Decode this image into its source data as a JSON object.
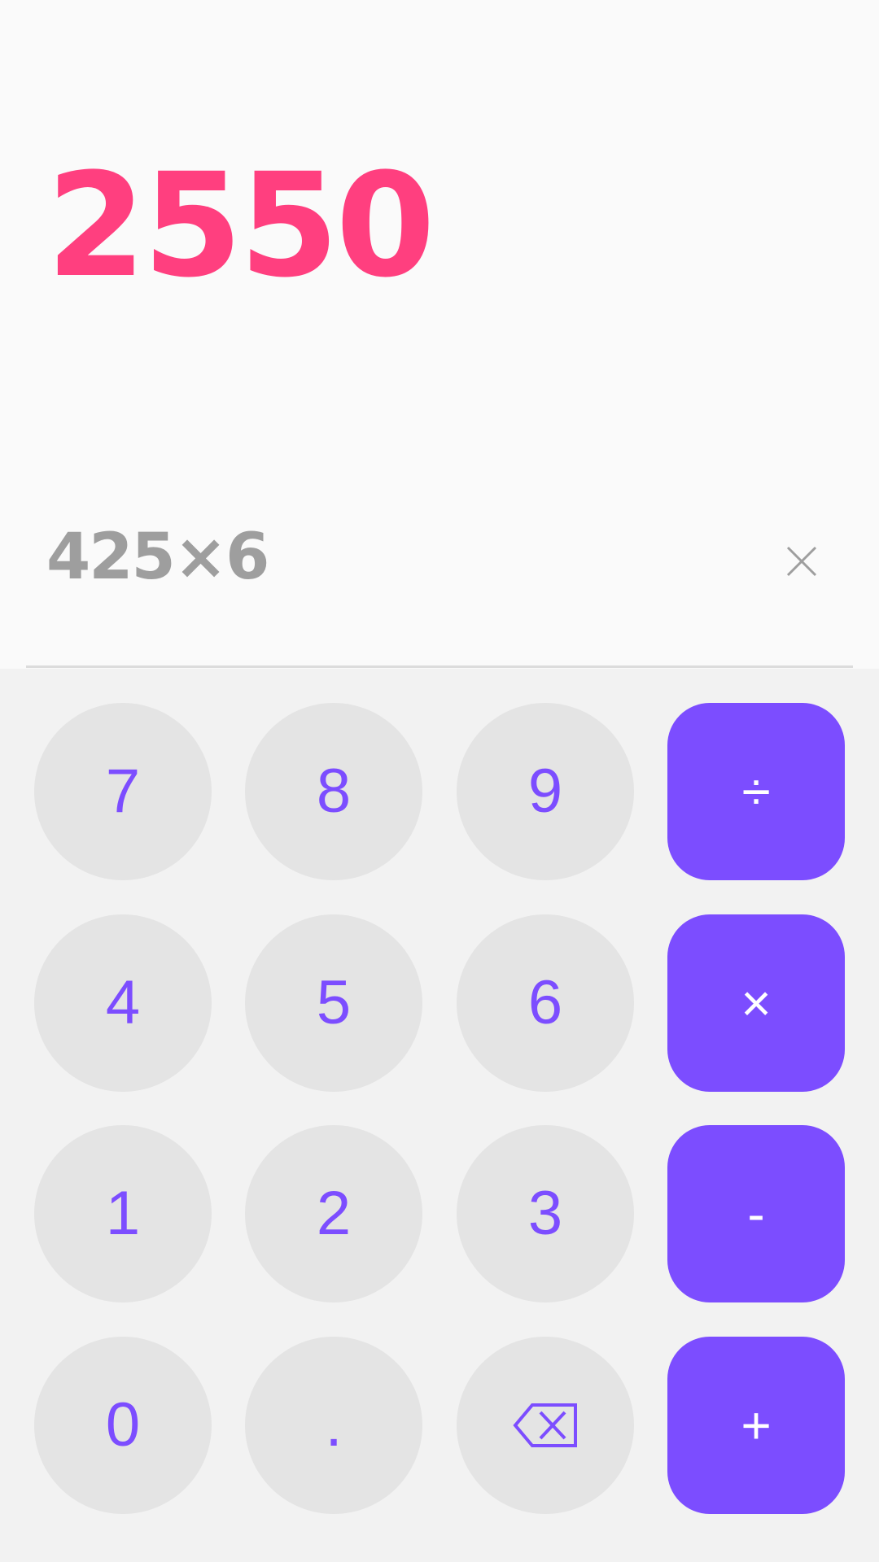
{
  "display": {
    "result": "2550",
    "expression": "425×6",
    "clear_icon": "close-icon"
  },
  "keypad": {
    "keys": [
      {
        "label": "7",
        "type": "digit"
      },
      {
        "label": "8",
        "type": "digit"
      },
      {
        "label": "9",
        "type": "digit"
      },
      {
        "label": "÷",
        "type": "operator"
      },
      {
        "label": "4",
        "type": "digit"
      },
      {
        "label": "5",
        "type": "digit"
      },
      {
        "label": "6",
        "type": "digit"
      },
      {
        "label": "×",
        "type": "operator"
      },
      {
        "label": "1",
        "type": "digit"
      },
      {
        "label": "2",
        "type": "digit"
      },
      {
        "label": "3",
        "type": "digit"
      },
      {
        "label": "-",
        "type": "operator"
      },
      {
        "label": "0",
        "type": "digit"
      },
      {
        "label": ".",
        "type": "digit"
      },
      {
        "label": "",
        "type": "backspace",
        "icon": "backspace-icon"
      },
      {
        "label": "+",
        "type": "operator"
      }
    ]
  },
  "colors": {
    "result": "#ff3f7f",
    "expression": "#9e9e9e",
    "accent": "#7c4dff",
    "key_background": "#e4e4e4",
    "operator_text": "#ffffff",
    "display_background": "#fafafa",
    "keypad_background": "#f2f2f2"
  }
}
